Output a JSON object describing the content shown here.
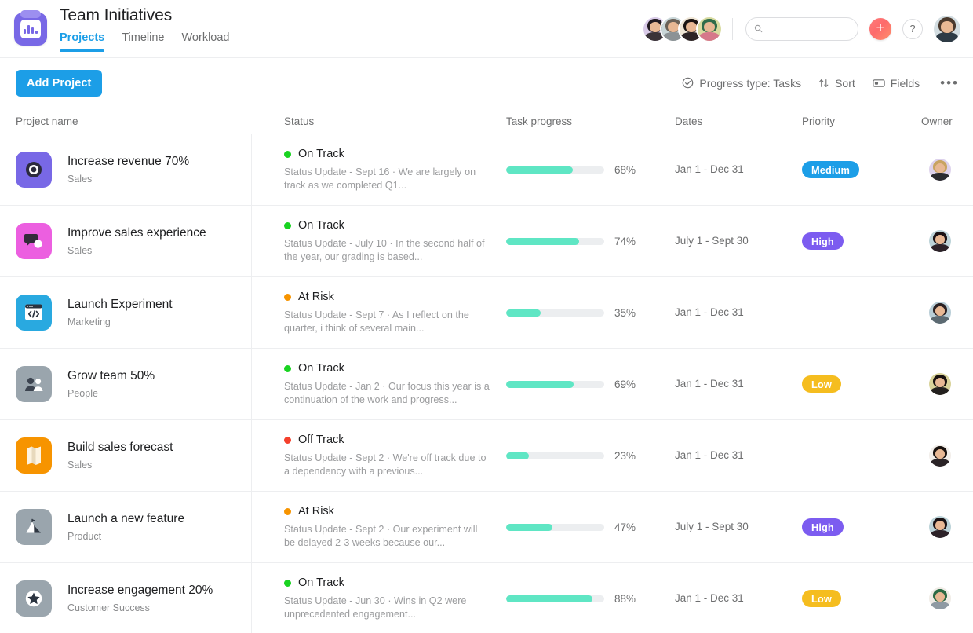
{
  "header": {
    "logo_icon": "bar-chart-logo-icon",
    "title": "Team Initiatives",
    "tabs": [
      {
        "label": "Projects",
        "active": true
      },
      {
        "label": "Timeline",
        "active": false
      },
      {
        "label": "Workload",
        "active": false
      }
    ],
    "member_avatars": [
      {
        "name": "member-avatar-1",
        "bg": "#d9cbe8",
        "hair": "#221a20",
        "body": "#3a3338"
      },
      {
        "name": "member-avatar-2",
        "bg": "#c9d6d8",
        "hair": "#6b6258",
        "body": "#8c9295"
      },
      {
        "name": "member-avatar-3",
        "bg": "#efe6d6",
        "hair": "#1b1412",
        "body": "#2c2426"
      },
      {
        "name": "member-avatar-4",
        "bg": "#d8dba0",
        "hair": "#2f6b4a",
        "body": "#d6788a"
      }
    ],
    "search": {
      "placeholder": "",
      "value": "",
      "icon": "search-icon"
    },
    "add_button": {
      "icon": "plus-icon",
      "label": "+"
    },
    "help_button": {
      "icon": "question-mark-icon",
      "label": "?"
    },
    "user_avatar": {
      "name": "user-avatar",
      "bg": "#d3dde1",
      "hair": "#4b3a2e",
      "body": "#2e3b45"
    }
  },
  "actionbar": {
    "add_project_label": "Add Project",
    "progress_type": {
      "label": "Progress type: Tasks",
      "icon": "check-circle-icon"
    },
    "sort": {
      "label": "Sort",
      "icon": "sort-arrows-icon"
    },
    "fields": {
      "label": "Fields",
      "icon": "fields-icon"
    },
    "overflow": {
      "label": "•••",
      "icon": "ellipsis-icon"
    }
  },
  "table": {
    "columns": [
      "Project name",
      "Status",
      "Task progress",
      "Dates",
      "Priority",
      "Owner"
    ],
    "rows": [
      {
        "icon": {
          "name": "target-icon",
          "bg": "#7868e6",
          "glyph": "target"
        },
        "name": "Increase revenue 70%",
        "team": "Sales",
        "status": {
          "label": "On Track",
          "color": "#19d321"
        },
        "status_update": "Status Update - Sept 16 · We are largely on track as we completed Q1...",
        "progress": 68,
        "progress_label": "68%",
        "dates": "Jan 1 - Dec 31",
        "priority": "Medium",
        "owner": {
          "name": "owner-avatar",
          "bg": "#ddd2ec",
          "hair": "#c8a461",
          "body": "#2b2b30"
        }
      },
      {
        "icon": {
          "name": "speech-bubble-icon",
          "bg": "#ec5fe0",
          "glyph": "chat"
        },
        "name": "Improve sales experience",
        "team": "Sales",
        "status": {
          "label": "On Track",
          "color": "#19d321"
        },
        "status_update": "Status Update - July 10 · In the second half of the year, our grading is based...",
        "progress": 74,
        "progress_label": "74%",
        "dates": "July 1 - Sept 30",
        "priority": "High",
        "owner": {
          "name": "owner-avatar",
          "bg": "#bcd3d8",
          "hair": "#1a1214",
          "body": "#2c2228"
        }
      },
      {
        "icon": {
          "name": "code-window-icon",
          "bg": "#29a9e0",
          "glyph": "code"
        },
        "name": "Launch Experiment",
        "team": "Marketing",
        "status": {
          "label": "At Risk",
          "color": "#f79400"
        },
        "status_update": "Status Update - Sept 7 · As I reflect on the quarter, i think of several main...",
        "progress": 35,
        "progress_label": "35%",
        "dates": "Jan 1 - Dec 31",
        "priority": "",
        "owner": {
          "name": "owner-avatar",
          "bg": "#b8cdd6",
          "hair": "#2a2022",
          "body": "#5c6a72"
        }
      },
      {
        "icon": {
          "name": "people-icon",
          "bg": "#9aa5ad",
          "glyph": "people"
        },
        "name": "Grow team 50%",
        "team": "People",
        "status": {
          "label": "On Track",
          "color": "#19d321"
        },
        "status_update": "Status Update - Jan 2 · Our focus this year is a continuation of the work and progress...",
        "progress": 69,
        "progress_label": "69%",
        "dates": "Jan 1 - Dec 31",
        "priority": "Low",
        "owner": {
          "name": "owner-avatar",
          "bg": "#d9d39a",
          "hair": "#19120f",
          "body": "#23201e"
        }
      },
      {
        "icon": {
          "name": "map-icon",
          "bg": "#f79400",
          "glyph": "map"
        },
        "name": "Build sales forecast",
        "team": "Sales",
        "status": {
          "label": "Off Track",
          "color": "#f4402c"
        },
        "status_update": "Status Update - Sept 2 · We're off track due to a dependency with a previous...",
        "progress": 23,
        "progress_label": "23%",
        "dates": "Jan 1 - Dec 31",
        "priority": "",
        "owner": {
          "name": "owner-avatar",
          "bg": "#f2eeea",
          "hair": "#19120f",
          "body": "#2a2326"
        }
      },
      {
        "icon": {
          "name": "mountain-icon",
          "bg": "#9aa5ad",
          "glyph": "mountain"
        },
        "name": "Launch a new feature",
        "team": "Product",
        "status": {
          "label": "At Risk",
          "color": "#f79400"
        },
        "status_update": "Status Update - Sept 2 · Our experiment will be delayed 2-3 weeks because our...",
        "progress": 47,
        "progress_label": "47%",
        "dates": "July 1 - Sept 30",
        "priority": "High",
        "owner": {
          "name": "owner-avatar",
          "bg": "#bcd3d8",
          "hair": "#1a1214",
          "body": "#2c2228"
        }
      },
      {
        "icon": {
          "name": "star-icon",
          "bg": "#9aa5ad",
          "glyph": "star"
        },
        "name": "Increase engagement 20%",
        "team": "Customer Success",
        "status": {
          "label": "On Track",
          "color": "#19d321"
        },
        "status_update": "Status Update - Jun 30 · Wins in Q2 were unprecedented engagement...",
        "progress": 88,
        "progress_label": "88%",
        "dates": "Jan 1 - Dec 31",
        "priority": "Low",
        "owner": {
          "name": "owner-avatar",
          "bg": "#f0ece6",
          "hair": "#2b6a44",
          "body": "#8f9aa3"
        }
      }
    ]
  },
  "colors": {
    "accent_blue": "#1c9ee7",
    "progress_green": "#5fe6c4",
    "priority_high": "#7c5cf0",
    "priority_medium": "#1c9ee7",
    "priority_low": "#f5bd1f"
  }
}
